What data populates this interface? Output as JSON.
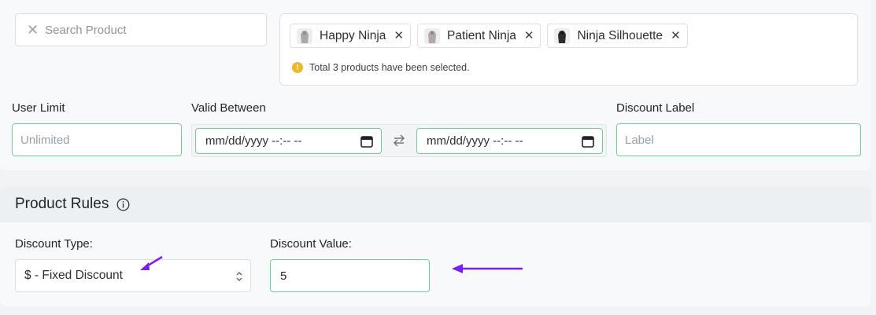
{
  "search": {
    "placeholder": "Search Product",
    "icon": "close-icon"
  },
  "selected_products": [
    {
      "name": "Happy Ninja",
      "icon": "hoodie-thumbnail"
    },
    {
      "name": "Patient Ninja",
      "icon": "hoodie-thumbnail"
    },
    {
      "name": "Ninja Silhouette",
      "icon": "hoodie-dark-thumbnail"
    }
  ],
  "selection_note": "Total 3 products have been selected.",
  "user_limit": {
    "label": "User Limit",
    "placeholder": "Unlimited"
  },
  "valid_between": {
    "label": "Valid Between",
    "start_placeholder": "mm/dd/yyyy --:-- --",
    "end_placeholder": "mm/dd/yyyy --:-- --"
  },
  "discount_label": {
    "label": "Discount Label",
    "placeholder": "Label"
  },
  "product_rules": {
    "title": "Product Rules",
    "discount_type_label": "Discount Type:",
    "discount_type_value": "$ - Fixed Discount",
    "discount_value_label": "Discount Value:",
    "discount_value": "5"
  },
  "colors": {
    "accent_border": "#6fcf97",
    "annotation_arrow": "#7a1ff2",
    "info": "#f2b822"
  }
}
